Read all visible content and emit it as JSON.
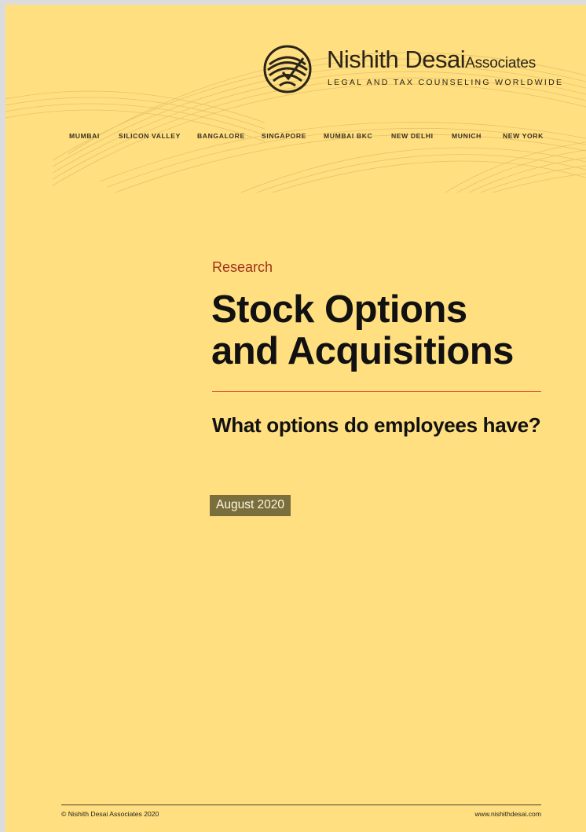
{
  "brand": {
    "name_main": "Nishith Desai",
    "name_suffix": "Associates",
    "tagline": "LEGAL AND TAX COUNSELING WORLDWIDE"
  },
  "cities": [
    "MUMBAI",
    "SILICON VALLEY",
    "BANGALORE",
    "SINGAPORE",
    "MUMBAI BKC",
    "NEW DELHI",
    "MUNICH",
    "NEW YORK"
  ],
  "cover": {
    "eyebrow": "Research",
    "title_line1": "Stock Options",
    "title_line2": "and Acquisitions",
    "subtitle": "What options do employees have?",
    "date": "August 2020"
  },
  "footer": {
    "copyright": "© Nishith Desai Associates 2020",
    "website": "www.nishithdesai.com"
  },
  "colors": {
    "page_background": "#ffdf80",
    "eyebrow": "#a0331c",
    "accent_rule": "#d64a2a",
    "date_badge": "#7a6e3c"
  }
}
